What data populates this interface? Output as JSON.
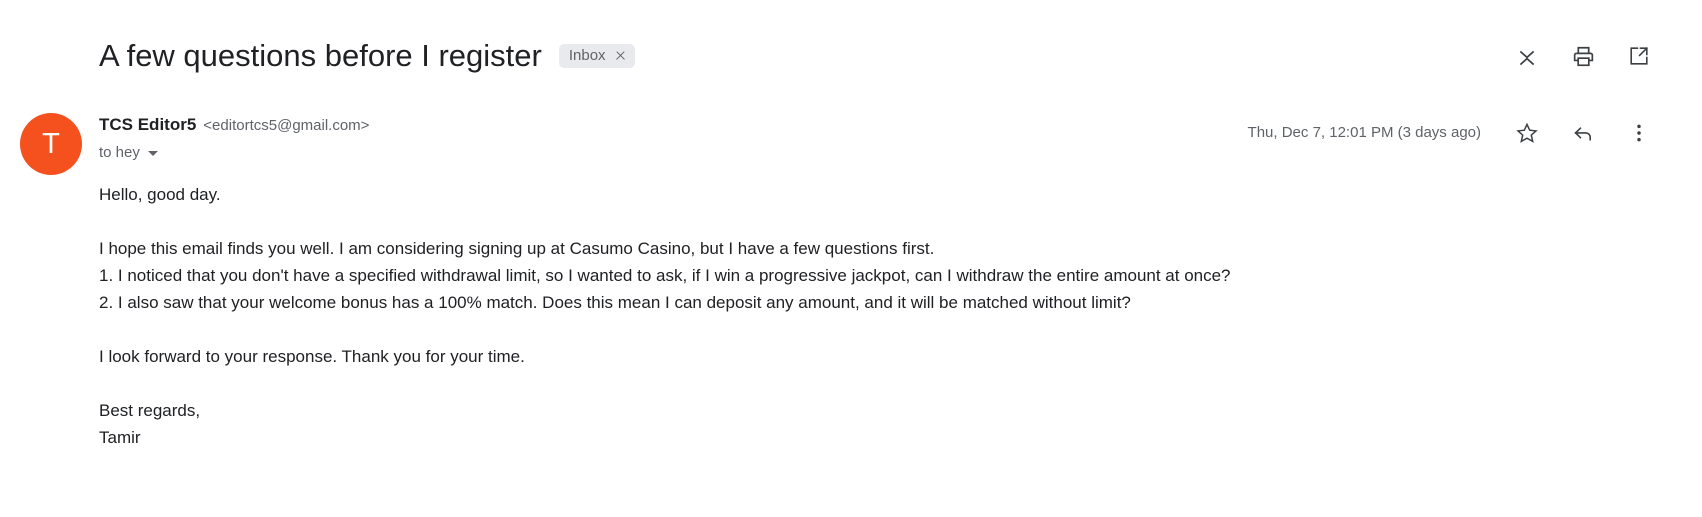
{
  "subject": {
    "title": "A few questions before I register",
    "label_chip": {
      "text": "Inbox",
      "close_icon": "close-icon"
    },
    "actions": [
      {
        "name": "collapse-all-button",
        "icon": "collapse-all-icon"
      },
      {
        "name": "print-button",
        "icon": "printer-icon"
      },
      {
        "name": "open-in-new-window-button",
        "icon": "open-in-new-icon"
      }
    ]
  },
  "message": {
    "avatar_letter": "T",
    "avatar_color": "#f4511e",
    "sender_name": "TCS Editor5",
    "sender_email": "<editortcs5@gmail.com>",
    "recipient": "to hey",
    "recipient_caret": "chevron-down-icon",
    "timestamp": "Thu, Dec 7, 12:01 PM (3 days ago)",
    "actions": [
      {
        "name": "star-button",
        "icon": "star-outline-icon"
      },
      {
        "name": "reply-button",
        "icon": "reply-arrow-icon"
      },
      {
        "name": "more-options-button",
        "icon": "more-vertical-icon"
      }
    ],
    "body": {
      "greeting": "Hello, good day.",
      "intro": "I hope this email finds you well. I am considering signing up at Casumo Casino, but I have a few questions first.",
      "question_1": "1. I noticed that you don't have a specified withdrawal limit, so I wanted to ask, if I win a progressive jackpot, can I withdraw the entire amount at once?",
      "question_2": "2. I also saw that your welcome bonus has a 100% match. Does this mean I can deposit any amount, and it will be matched without limit?",
      "closing": "I look forward to your response. Thank you for your time.",
      "signoff": "Best regards,",
      "signature": "Tamir"
    }
  }
}
